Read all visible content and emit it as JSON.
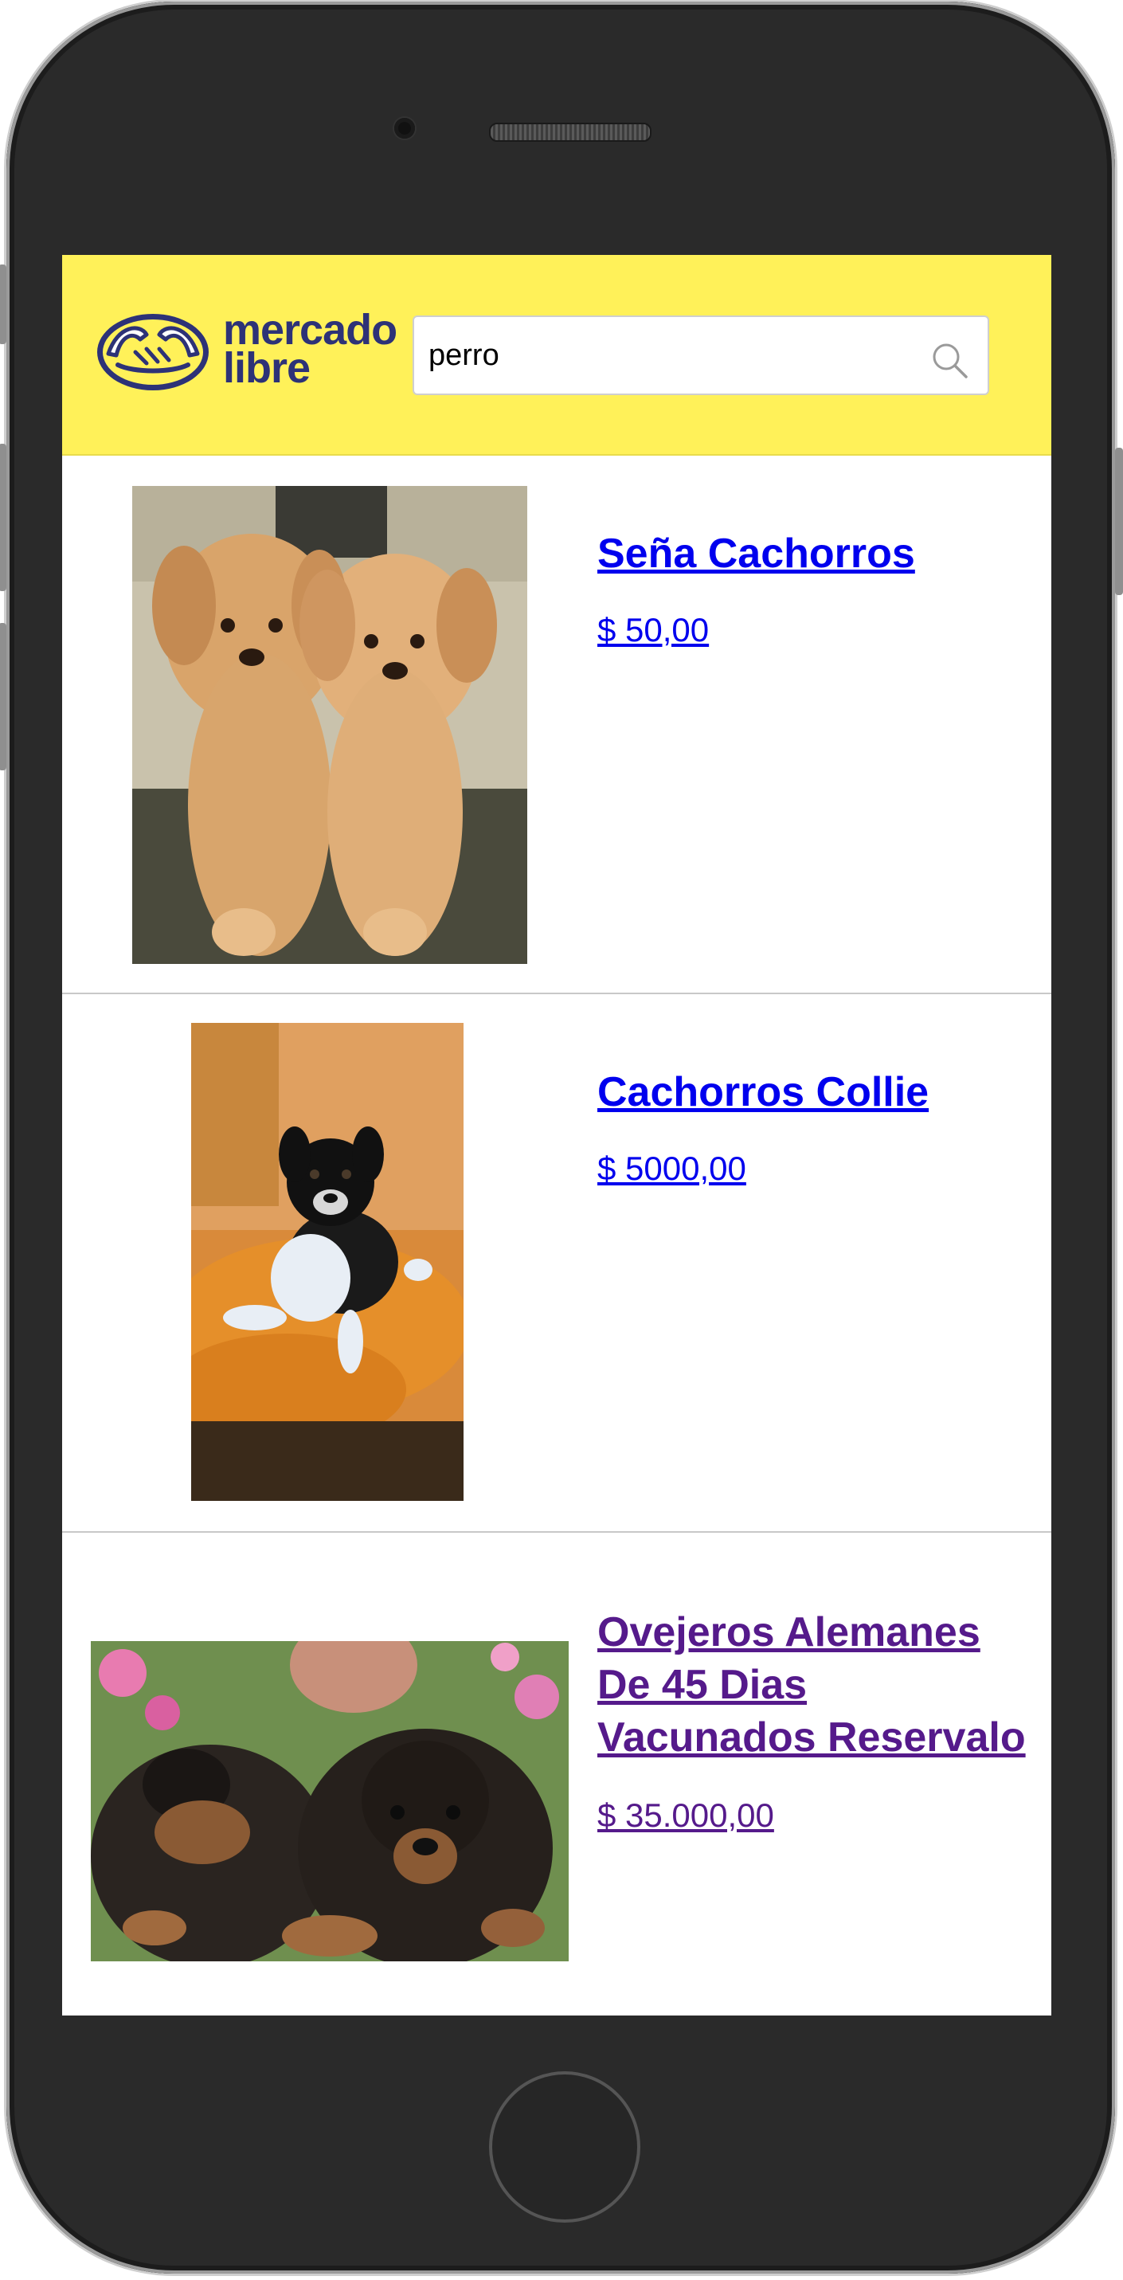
{
  "header": {
    "logo": {
      "line1": "mercado",
      "line2": "libre"
    },
    "search": {
      "value": "perro",
      "placeholder": ""
    }
  },
  "results": [
    {
      "title": "Seña Cachorros",
      "price": "$ 50,00",
      "image": "golden-retriever-puppies-photo",
      "visited": false
    },
    {
      "title": "Cachorros Collie",
      "price": "$ 5000,00",
      "image": "collie-puppy-photo",
      "visited": false
    },
    {
      "title": "Ovejeros Alemanes De 45 Dias Vacunados Reservalo",
      "price": "$ 35.000,00",
      "image": "german-shepherd-puppies-photo",
      "visited": true
    }
  ],
  "colors": {
    "header_bg": "#fff159",
    "logo_blue": "#2d3277",
    "link": "#0000ee",
    "visited_link": "#551a8b"
  }
}
